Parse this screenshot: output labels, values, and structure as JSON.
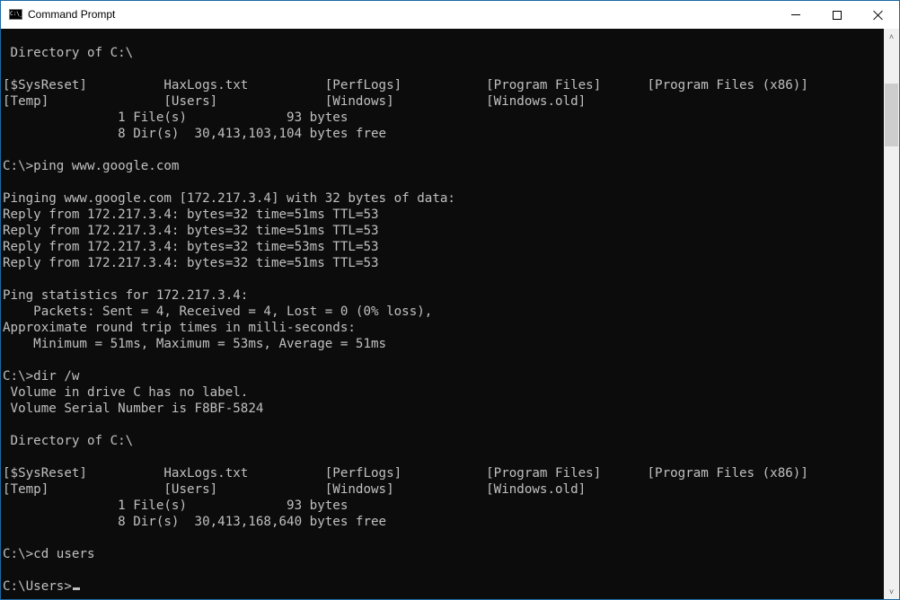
{
  "window": {
    "title": "Command Prompt",
    "app_icon_text": "C:\\_",
    "icons": {
      "app": "cmd-icon",
      "minimize": "minimize-icon",
      "maximize": "maximize-icon",
      "close": "close-icon"
    }
  },
  "console": {
    "lines": [
      " Directory of C:\\",
      "",
      "[$SysReset]          HaxLogs.txt          [PerfLogs]           [Program Files]      [Program Files (x86)]",
      "[Temp]               [Users]              [Windows]            [Windows.old]",
      "               1 File(s)             93 bytes",
      "               8 Dir(s)  30,413,103,104 bytes free",
      "",
      "C:\\>ping www.google.com",
      "",
      "Pinging www.google.com [172.217.3.4] with 32 bytes of data:",
      "Reply from 172.217.3.4: bytes=32 time=51ms TTL=53",
      "Reply from 172.217.3.4: bytes=32 time=51ms TTL=53",
      "Reply from 172.217.3.4: bytes=32 time=53ms TTL=53",
      "Reply from 172.217.3.4: bytes=32 time=51ms TTL=53",
      "",
      "Ping statistics for 172.217.3.4:",
      "    Packets: Sent = 4, Received = 4, Lost = 0 (0% loss),",
      "Approximate round trip times in milli-seconds:",
      "    Minimum = 51ms, Maximum = 53ms, Average = 51ms",
      "",
      "C:\\>dir /w",
      " Volume in drive C has no label.",
      " Volume Serial Number is F8BF-5824",
      "",
      " Directory of C:\\",
      "",
      "[$SysReset]          HaxLogs.txt          [PerfLogs]           [Program Files]      [Program Files (x86)]",
      "[Temp]               [Users]              [Windows]            [Windows.old]",
      "               1 File(s)             93 bytes",
      "               8 Dir(s)  30,413,168,640 bytes free",
      "",
      "C:\\>cd users",
      ""
    ],
    "prompt": "C:\\Users>",
    "input": ""
  },
  "scrollbar": {
    "up_glyph": "˄",
    "down_glyph": "˅"
  },
  "colors": {
    "background": "#0c0c0c",
    "foreground": "#c0c0c0",
    "border": "#1b6aa5"
  }
}
